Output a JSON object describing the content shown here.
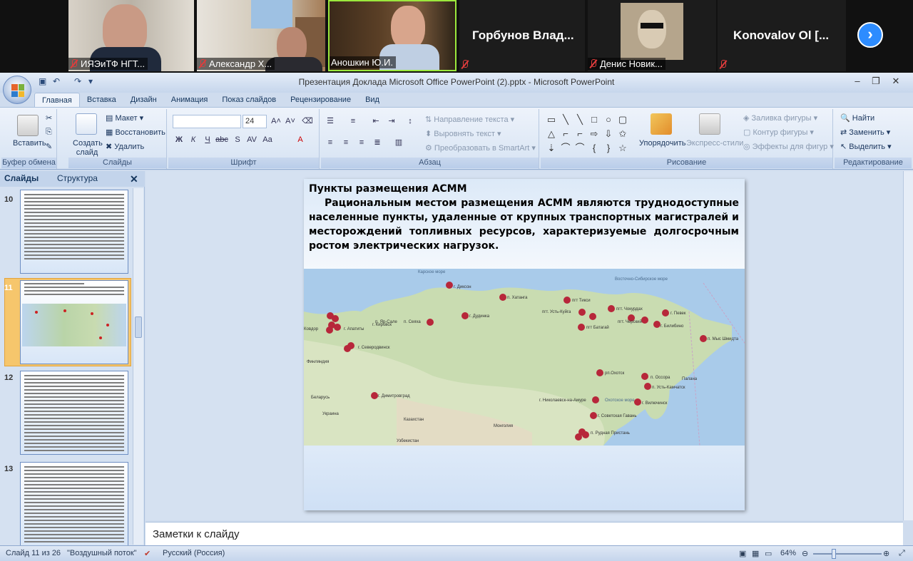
{
  "participants": [
    {
      "name": "ИЯЭиТФ НГТ...",
      "muted": true
    },
    {
      "name": "Александр Х...",
      "muted": true
    },
    {
      "name": "Аношкин Ю.И.",
      "muted": false
    },
    {
      "name": "Горбунов Влад...",
      "muted": true
    },
    {
      "name": "Денис Новик...",
      "muted": true
    },
    {
      "name": "Konovalov Ol [...",
      "muted": true
    }
  ],
  "next_page_icon": "chevron-right-icon",
  "window": {
    "title": "Презентация Доклада Microsoft Office PowerPoint (2).pptx - Microsoft PowerPoint"
  },
  "ribbon": {
    "tabs": [
      "Главная",
      "Вставка",
      "Дизайн",
      "Анимация",
      "Показ слайдов",
      "Рецензирование",
      "Вид"
    ],
    "active_tab": "Главная",
    "clipboard": {
      "paste": "Вставить",
      "group": "Буфер обмена"
    },
    "slides": {
      "create": "Создать слайд",
      "layout": "Макет",
      "reset": "Восстановить",
      "delete": "Удалить",
      "group": "Слайды"
    },
    "font": {
      "size": "24",
      "group": "Шрифт"
    },
    "paragraph": {
      "text_direction": "Направление текста",
      "align_text": "Выровнять текст",
      "smartart": "Преобразовать в SmartArt",
      "group": "Абзац"
    },
    "drawing": {
      "arrange": "Упорядочить",
      "quick_styles": "Экспресс-стили",
      "fill": "Заливка фигуры",
      "outline": "Контур фигуры",
      "effects": "Эффекты для фигур",
      "group": "Рисование"
    },
    "editing": {
      "find": "Найти",
      "replace": "Заменить",
      "select": "Выделить",
      "group": "Редактирование"
    }
  },
  "left_panel": {
    "tab_slides": "Слайды",
    "tab_outline": "Структура",
    "thumbnails": [
      {
        "number": "10"
      },
      {
        "number": "11"
      },
      {
        "number": "12"
      },
      {
        "number": "13"
      }
    ]
  },
  "slide": {
    "title": "Пункты размещения АСММ",
    "body": "Рациональным местом размещения АСММ являются труднодоступные населенные пункты, удаленные от крупных транспортных магистралей и месторождений топливных ресурсов, характеризуемые долгосрочным ростом электрических нагрузок.",
    "map_labels": {
      "dikson": "г. Диксон",
      "khatanga": "п. Хатанга",
      "dudinka": "г. Дудинка",
      "kirovsk": "г. Кировск",
      "apatity": "г. Апатиты",
      "severodvinsk": "г. Северодвинск",
      "dimitrovgrad": "г. Димитровград",
      "tiksi": "пгт Тикси",
      "ust_kuiga": "пгт. Усть-Куйга",
      "chokurdakh": "пгт. Чокурдах",
      "cherskiy": "пгт. Черский",
      "batagay": "пгт Батагай",
      "pevek": "г. Певек",
      "bilibino": "г. Билибино",
      "mys_shmidta": "п. Мыс Шмидта",
      "okhotsk": "рп.Охотск",
      "ossora": "п. Оссора",
      "palana": "Палана",
      "ust_kamchatsk": "п. Усть-Камчатск",
      "vilyuchinsk": "г. Вилючинск",
      "nikolaevsk": "г. Николаевск-на-Амуре",
      "sovgavan": "г. Советская Гавань",
      "rudnaya": "п. Рудная Пристань",
      "kovdor": "Ковдор",
      "finland": "Финляндия",
      "belarus": "Беларусь",
      "ukraine": "Украина",
      "kazakhstan": "Казахстан",
      "mongolia": "Монголия",
      "uzbekistan": "Узбекистан",
      "kara_sea": "Карское море",
      "east_siberian_sea": "Восточно-Сибирское море",
      "okhotsk_sea": "Охотское море",
      "yamal": "п. Яр-Сале",
      "seyaha": "п. Сеяха"
    }
  },
  "notes": {
    "placeholder": "Заметки к слайду"
  },
  "statusbar": {
    "slide_info": "Слайд 11 из 26",
    "theme": "\"Воздушный поток\"",
    "language": "Русский (Россия)",
    "zoom": "64%"
  }
}
